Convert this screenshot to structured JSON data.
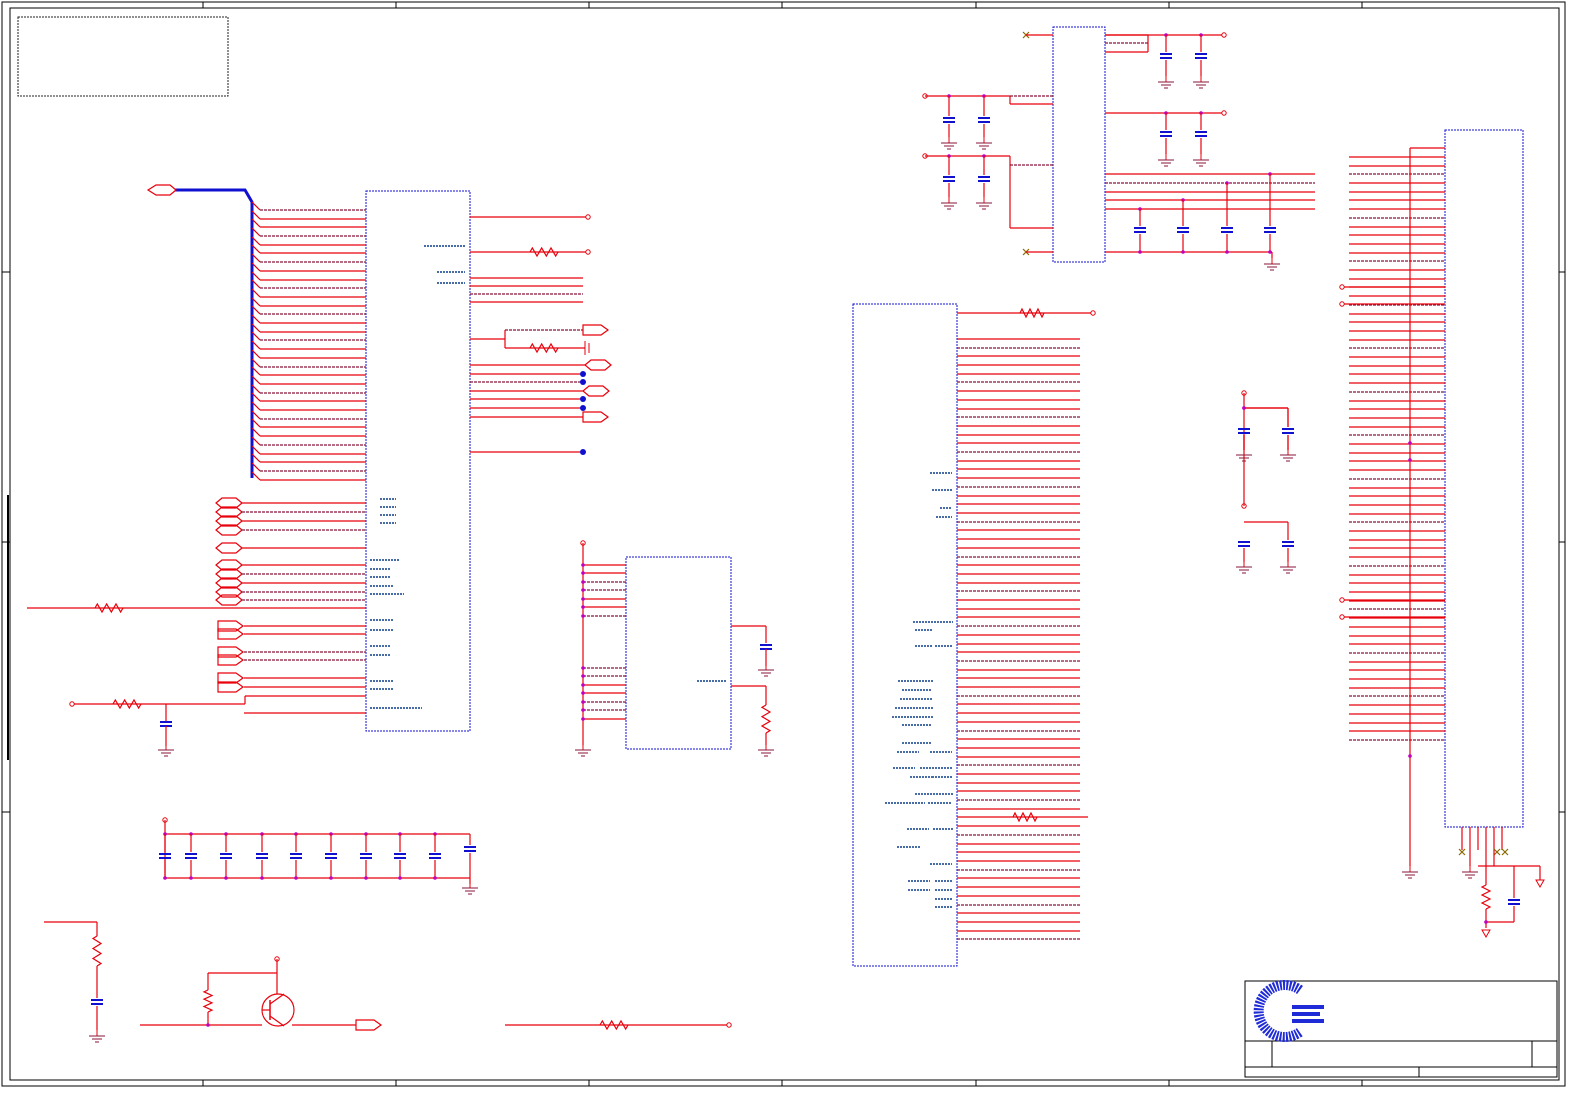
{
  "sheet": {
    "title_block_text": [],
    "note_box_text": []
  },
  "colors": {
    "wire": "#e8000b",
    "wire_dark": "#8a1538",
    "part_outline": "#1010d0",
    "pin_label": "#0a3c8c",
    "junction": "#c000c0",
    "frame": "#000000",
    "logo": "#1e2bd6",
    "no_connect": "#8a6a00"
  },
  "icons": [
    "logo-icon",
    "ground-icon",
    "resistor-icon",
    "capacitor-icon",
    "transistor-icon",
    "off-page-connector-icon",
    "no-connect-icon"
  ]
}
